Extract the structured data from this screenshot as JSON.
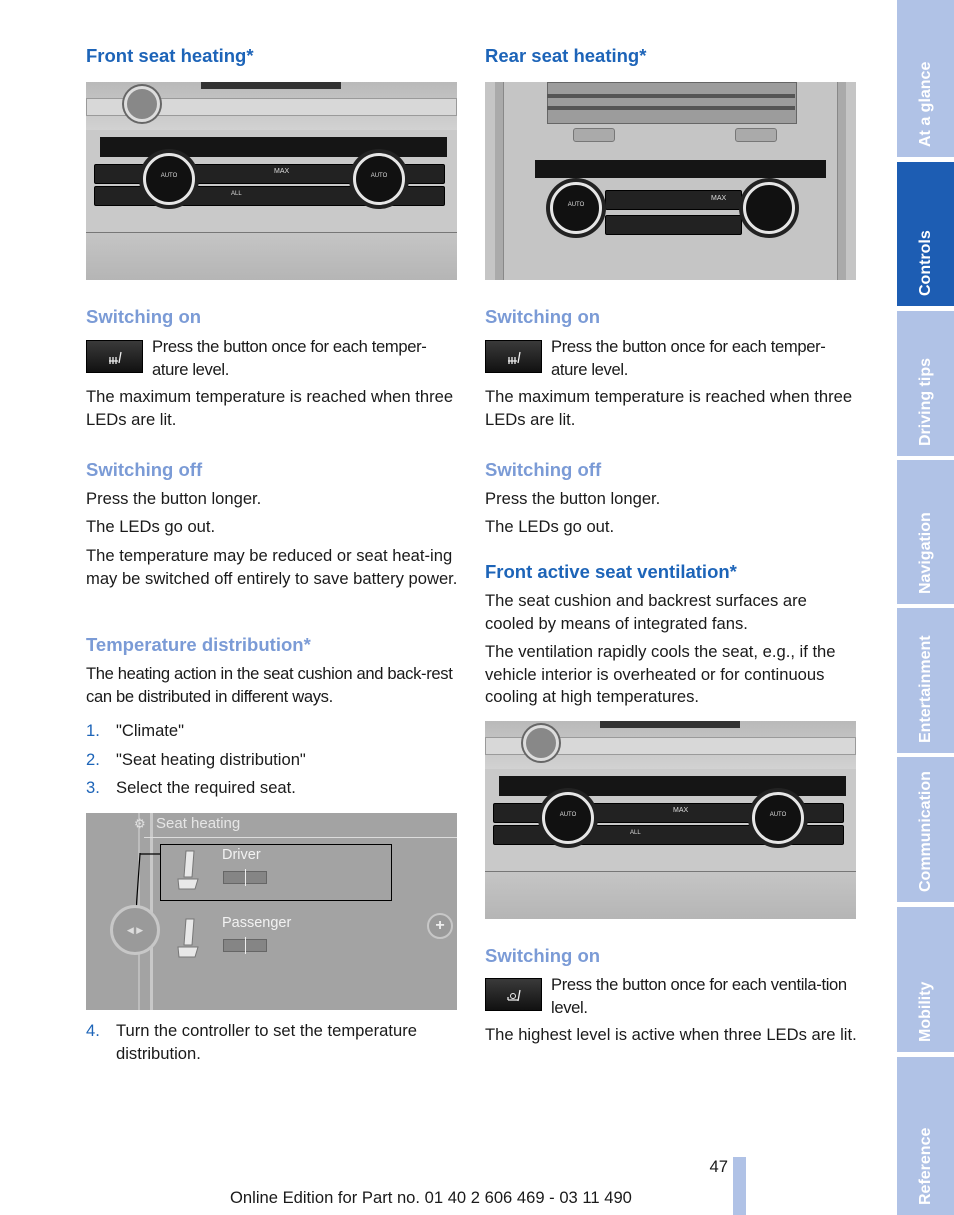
{
  "left_column": {
    "front_seat_heating": {
      "heading": "Front seat heating*",
      "image": "climate-control-panel-front",
      "switching_on": {
        "heading": "Switching on",
        "button_icon": "seat-heating-icon",
        "instruction": "Press the button once for each temper-ature level.",
        "note": "The maximum temperature is reached when three LEDs are lit."
      },
      "switching_off": {
        "heading": "Switching off",
        "paragraphs": [
          "Press the button longer.",
          "The LEDs go out.",
          "The temperature may be reduced or seat heat-ing may be switched off entirely to save battery power."
        ]
      },
      "temperature_distribution": {
        "heading": "Temperature distribution*",
        "intro": "The heating action in the seat cushion and back-rest can be distributed in different ways.",
        "steps": [
          {
            "num": "1.",
            "text": "\"Climate\""
          },
          {
            "num": "2.",
            "text": "\"Seat heating distribution\""
          },
          {
            "num": "3.",
            "text": "Select the required seat."
          },
          {
            "num": "4.",
            "text": "Turn the controller to set the temperature distribution."
          }
        ],
        "screen": {
          "title": "Seat heating",
          "title_icon": "seat-settings-icon",
          "seats": [
            {
              "label": "Driver",
              "selected": true,
              "distribution": 0.5
            },
            {
              "label": "Passenger",
              "selected": false,
              "distribution": 0.5
            }
          ],
          "controller_icon": "controller-arrows-icon",
          "plus_icon": "plus-icon"
        }
      }
    }
  },
  "right_column": {
    "rear_seat_heating": {
      "heading": "Rear seat heating*",
      "image": "climate-control-panel-rear",
      "switching_on": {
        "heading": "Switching on",
        "button_icon": "seat-heating-icon",
        "instruction": "Press the button once for each temper-ature level.",
        "note": "The maximum temperature is reached when three LEDs are lit."
      },
      "switching_off": {
        "heading": "Switching off",
        "paragraphs": [
          "Press the button longer.",
          "The LEDs go out."
        ]
      }
    },
    "front_active_seat_ventilation": {
      "heading": "Front active seat ventilation*",
      "paragraphs": [
        "The seat cushion and backrest surfaces are cooled by means of integrated fans.",
        "The ventilation rapidly cools the seat, e.g., if the vehicle interior is overheated or for continuous cooling at high temperatures."
      ],
      "image": "climate-control-panel-front",
      "switching_on": {
        "heading": "Switching on",
        "button_icon": "seat-ventilation-icon",
        "instruction": "Press the button once for each ventila-tion level.",
        "note": "The highest level is active when three LEDs are lit."
      }
    }
  },
  "panel_labels": {
    "auto": "AUTO",
    "max": "MAX",
    "all": "ALL"
  },
  "sidebar": {
    "tabs": [
      {
        "label": "At a glance",
        "active": false
      },
      {
        "label": "Controls",
        "active": true
      },
      {
        "label": "Driving tips",
        "active": false
      },
      {
        "label": "Navigation",
        "active": false
      },
      {
        "label": "Entertainment",
        "active": false
      },
      {
        "label": "Communication",
        "active": false
      },
      {
        "label": "Mobility",
        "active": false
      },
      {
        "label": "Reference",
        "active": false
      }
    ]
  },
  "footer": {
    "page_number": "47",
    "edition": "Online Edition for Part no. 01 40 2 606 469 - 03 11 490"
  },
  "colors": {
    "heading_blue": "#1d64b8",
    "subheading_blue": "#7b9bd6",
    "sidebar_tab": "#b0c2e6",
    "sidebar_active": "#1d5db3"
  }
}
